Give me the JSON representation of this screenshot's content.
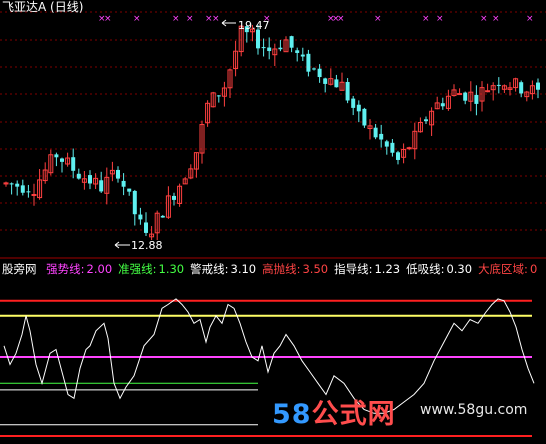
{
  "header": {
    "title": "飞亚达A (日线)",
    "high_label": "19.47",
    "low_label": "12.88"
  },
  "indicator": {
    "name": "股旁网",
    "items": [
      {
        "label": "强势线:",
        "value": "2.00",
        "label_color": "#ff44ff",
        "value_color": "#ff44ff"
      },
      {
        "label": "准强线:",
        "value": "1.30",
        "label_color": "#44ff44",
        "value_color": "#44ff44"
      },
      {
        "label": "警戒线:",
        "value": "3.10",
        "label_color": "#ffffff",
        "value_color": "#ffffff"
      },
      {
        "label": "高抛线:",
        "value": "3.50",
        "label_color": "#ff4444",
        "value_color": "#ff4444"
      },
      {
        "label": "指导线:",
        "value": "1.23",
        "label_color": "#ffffff",
        "value_color": "#ffffff"
      },
      {
        "label": "低吸线:",
        "value": "0.30",
        "label_color": "#ffffff",
        "value_color": "#ffffff"
      },
      {
        "label": "大底区域:",
        "value": "0",
        "label_color": "#ff4444",
        "value_color": "#ff4444"
      }
    ]
  },
  "watermark": {
    "logo_num": "58",
    "logo_text": "公式网",
    "site": "www.58gu.com"
  },
  "colors": {
    "up": "#ff4040",
    "down": "#5ff0f0",
    "marker": "#ff44ff",
    "strong_line": "#ff44ff",
    "quasi_line": "#44ff44",
    "sell_line": "#ff2020",
    "guide_line": "#ffffff",
    "yellow_line": "#ffff66",
    "dashed_grid": "#800000"
  },
  "chart_data": {
    "type": "candlestick",
    "price_range": [
      12.88,
      19.47
    ],
    "high": 19.47,
    "low": 12.88,
    "indicator_range": [
      0,
      4
    ],
    "levels": {
      "high_sell": 3.5,
      "warning": 3.1,
      "strong": 2.0,
      "quasi_strong": 1.3,
      "guide": 1.23,
      "low_buy": 0.3
    }
  }
}
